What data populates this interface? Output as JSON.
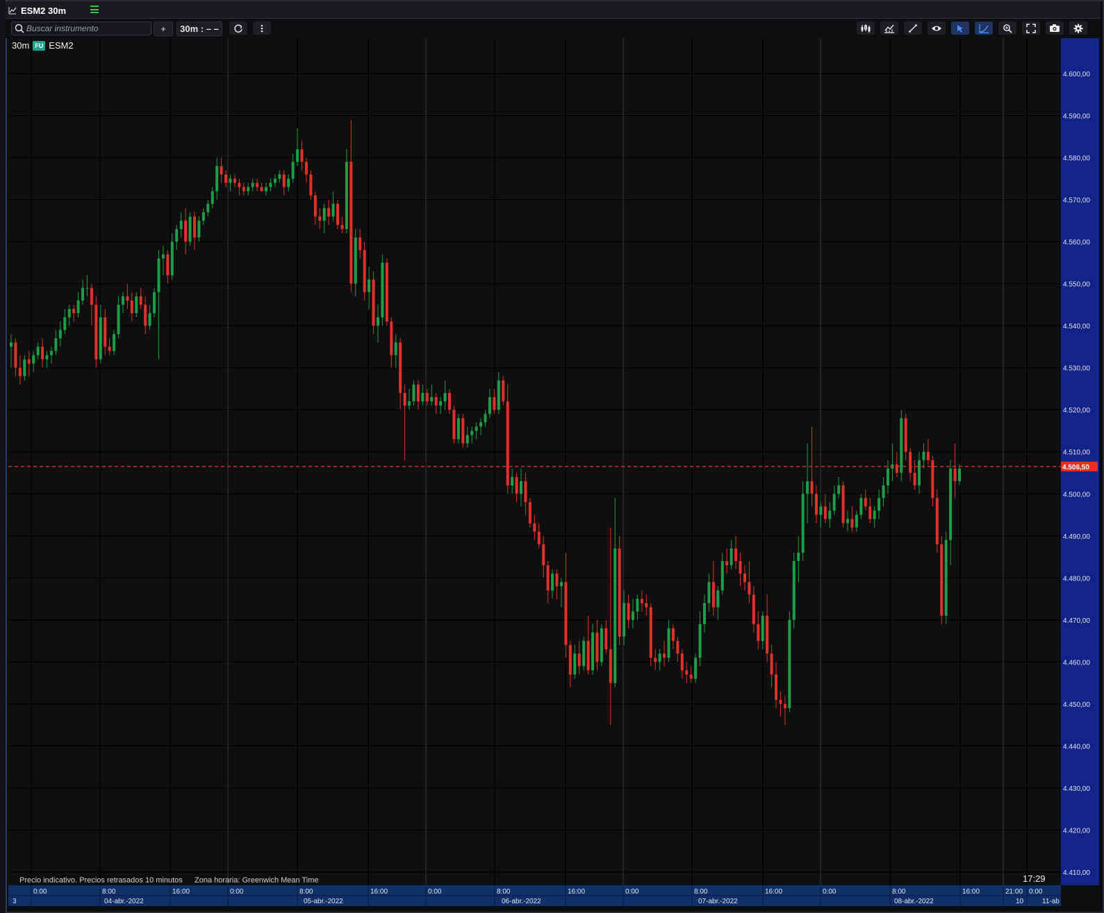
{
  "window": {
    "title": "ESM2 30m"
  },
  "toolbar": {
    "search_placeholder": "Buscar instrumento",
    "add_label": "+",
    "interval_label": "30m : – –",
    "icons": [
      "search-icon",
      "plus-icon",
      "refresh-icon",
      "more-vertical-icon",
      "bar-style-icon",
      "indicators-icon",
      "draw-line-icon",
      "visibility-icon",
      "cursor-icon",
      "curve-draw-icon",
      "zoom-icon",
      "fullscreen-icon",
      "camera-icon",
      "settings-icon"
    ]
  },
  "legend": {
    "interval": "30m",
    "badge": "FU",
    "symbol": "ESM2"
  },
  "footer": {
    "note": "Precio indicativo. Precios retrasados 10 minutos",
    "timezone": "Zona horaria: Greenwich Mean Time",
    "clock": "17:29"
  },
  "colors": {
    "up": "#1f9e4a",
    "down": "#e0322b",
    "axis_bg": "#12248a",
    "time_axis_bg": "#10306b",
    "last_price": "#e0322b"
  },
  "chart_data": {
    "type": "candlestick",
    "y_axis_labels": [
      "4.600,00",
      "4.590,00",
      "4.580,00",
      "4.570,00",
      "4.560,00",
      "4.550,00",
      "4.540,00",
      "4.530,00",
      "4.520,00",
      "4.510,00",
      "4.500,00",
      "4.490,00",
      "4.480,00",
      "4.470,00",
      "4.460,00",
      "4.450,00",
      "4.440,00",
      "4.430,00",
      "4.420,00",
      "4.410,00"
    ],
    "ylim": [
      4408,
      4612
    ],
    "last_price": 4506.5,
    "last_price_label": "4.506,50",
    "time_ticks": [
      "0:00",
      "8:00",
      "16:00",
      "0:00",
      "8:00",
      "16:00",
      "0:00",
      "8:00",
      "16:00",
      "0:00",
      "8:00",
      "16:00",
      "0:00",
      "8:00",
      "16:00",
      "21:00",
      "0:00"
    ],
    "date_labels": [
      "3",
      "04-abr.-2022",
      "05-abr.-2022",
      "06-abr.-2022",
      "07-abr.-2022",
      "08-abr.-2022",
      "10",
      "11-ab"
    ],
    "grid": true,
    "ohlc": [
      [
        4535,
        4538,
        4530,
        4536
      ],
      [
        4536,
        4537,
        4528,
        4530
      ],
      [
        4530,
        4533,
        4526,
        4528
      ],
      [
        4528,
        4533,
        4527,
        4532
      ],
      [
        4532,
        4534,
        4528,
        4531
      ],
      [
        4531,
        4534,
        4529,
        4533
      ],
      [
        4533,
        4536,
        4532,
        4535
      ],
      [
        4535,
        4537,
        4530,
        4532
      ],
      [
        4532,
        4534,
        4530,
        4533
      ],
      [
        4533,
        4535,
        4531,
        4534
      ],
      [
        4534,
        4539,
        4533,
        4537
      ],
      [
        4537,
        4541,
        4535,
        4539
      ],
      [
        4539,
        4544,
        4538,
        4542
      ],
      [
        4542,
        4545,
        4540,
        4544
      ],
      [
        4544,
        4545,
        4541,
        4543
      ],
      [
        4543,
        4548,
        4542,
        4546
      ],
      [
        4546,
        4551,
        4545,
        4549
      ],
      [
        4549,
        4552,
        4547,
        4549
      ],
      [
        4549,
        4550,
        4540,
        4545
      ],
      [
        4545,
        4547,
        4530,
        4532
      ],
      [
        4532,
        4545,
        4531,
        4542
      ],
      [
        4542,
        4544,
        4533,
        4535
      ],
      [
        4535,
        4537,
        4533,
        4534
      ],
      [
        4534,
        4539,
        4533,
        4538
      ],
      [
        4538,
        4547,
        4537,
        4545
      ],
      [
        4545,
        4548,
        4543,
        4547
      ],
      [
        4547,
        4550,
        4544,
        4546
      ],
      [
        4546,
        4548,
        4541,
        4543
      ],
      [
        4543,
        4548,
        4542,
        4547
      ],
      [
        4547,
        4549,
        4544,
        4545
      ],
      [
        4545,
        4547,
        4538,
        4540
      ],
      [
        4540,
        4545,
        4539,
        4543
      ],
      [
        4543,
        4549,
        4542,
        4548
      ],
      [
        4548,
        4558,
        4532,
        4556
      ],
      [
        4556,
        4559,
        4552,
        4557
      ],
      [
        4557,
        4558,
        4550,
        4552
      ],
      [
        4552,
        4562,
        4551,
        4560
      ],
      [
        4560,
        4564,
        4558,
        4563
      ],
      [
        4563,
        4567,
        4561,
        4565
      ],
      [
        4565,
        4568,
        4557,
        4560
      ],
      [
        4560,
        4567,
        4559,
        4566
      ],
      [
        4566,
        4567,
        4558,
        4561
      ],
      [
        4561,
        4566,
        4560,
        4565
      ],
      [
        4565,
        4568,
        4564,
        4567
      ],
      [
        4567,
        4570,
        4566,
        4569
      ],
      [
        4569,
        4573,
        4568,
        4572
      ],
      [
        4572,
        4580,
        4570,
        4578
      ],
      [
        4578,
        4580,
        4574,
        4576
      ],
      [
        4576,
        4577,
        4573,
        4574
      ],
      [
        4574,
        4576,
        4572,
        4575
      ],
      [
        4575,
        4576,
        4573,
        4574
      ],
      [
        4574,
        4575,
        4571,
        4573
      ],
      [
        4573,
        4574,
        4571,
        4572
      ],
      [
        4572,
        4574,
        4571,
        4573
      ],
      [
        4573,
        4575,
        4572,
        4574
      ],
      [
        4574,
        4575,
        4572,
        4573
      ],
      [
        4573,
        4574,
        4572,
        4572
      ],
      [
        4572,
        4574,
        4571,
        4573
      ],
      [
        4573,
        4575,
        4572,
        4574
      ],
      [
        4574,
        4576,
        4573,
        4575
      ],
      [
        4575,
        4577,
        4574,
        4576
      ],
      [
        4576,
        4577,
        4571,
        4573
      ],
      [
        4573,
        4576,
        4572,
        4575
      ],
      [
        4575,
        4581,
        4574,
        4579
      ],
      [
        4579,
        4587,
        4578,
        4582
      ],
      [
        4582,
        4584,
        4577,
        4579
      ],
      [
        4579,
        4580,
        4574,
        4576
      ],
      [
        4576,
        4577,
        4570,
        4571
      ],
      [
        4571,
        4572,
        4564,
        4566
      ],
      [
        4566,
        4568,
        4563,
        4565
      ],
      [
        4565,
        4569,
        4562,
        4568
      ],
      [
        4568,
        4570,
        4564,
        4566
      ],
      [
        4566,
        4572,
        4565,
        4569
      ],
      [
        4569,
        4570,
        4563,
        4564
      ],
      [
        4564,
        4566,
        4562,
        4563
      ],
      [
        4563,
        4582,
        4562,
        4579
      ],
      [
        4579,
        4589,
        4548,
        4550
      ],
      [
        4550,
        4563,
        4547,
        4561
      ],
      [
        4561,
        4563,
        4556,
        4558
      ],
      [
        4558,
        4560,
        4546,
        4548
      ],
      [
        4548,
        4554,
        4544,
        4551
      ],
      [
        4551,
        4553,
        4538,
        4540
      ],
      [
        4540,
        4545,
        4536,
        4542
      ],
      [
        4542,
        4557,
        4540,
        4555
      ],
      [
        4555,
        4556,
        4540,
        4541
      ],
      [
        4541,
        4542,
        4530,
        4533
      ],
      [
        4533,
        4538,
        4530,
        4536
      ],
      [
        4536,
        4537,
        4520,
        4524
      ],
      [
        4524,
        4526,
        4508,
        4521
      ],
      [
        4521,
        4525,
        4520,
        4522
      ],
      [
        4522,
        4527,
        4521,
        4526
      ],
      [
        4526,
        4527,
        4520,
        4522
      ],
      [
        4522,
        4526,
        4521,
        4524
      ],
      [
        4524,
        4525,
        4521,
        4522
      ],
      [
        4522,
        4526,
        4521,
        4523
      ],
      [
        4523,
        4524,
        4519,
        4521
      ],
      [
        4521,
        4523,
        4519,
        4522
      ],
      [
        4522,
        4527,
        4520,
        4524
      ],
      [
        4524,
        4525,
        4519,
        4520
      ],
      [
        4520,
        4521,
        4512,
        4513
      ],
      [
        4513,
        4519,
        4512,
        4518
      ],
      [
        4518,
        4519,
        4511,
        4512
      ],
      [
        4512,
        4516,
        4511,
        4514
      ],
      [
        4514,
        4516,
        4512,
        4515
      ],
      [
        4515,
        4517,
        4513,
        4516
      ],
      [
        4516,
        4518,
        4514,
        4517
      ],
      [
        4517,
        4520,
        4516,
        4519
      ],
      [
        4519,
        4525,
        4518,
        4523
      ],
      [
        4523,
        4525,
        4519,
        4520
      ],
      [
        4520,
        4529,
        4519,
        4527
      ],
      [
        4527,
        4528,
        4521,
        4522
      ],
      [
        4522,
        4526,
        4500,
        4502
      ],
      [
        4502,
        4506,
        4500,
        4504
      ],
      [
        4504,
        4505,
        4498,
        4500
      ],
      [
        4500,
        4506,
        4497,
        4503
      ],
      [
        4503,
        4505,
        4495,
        4498
      ],
      [
        4498,
        4499,
        4492,
        4493
      ],
      [
        4493,
        4495,
        4489,
        4491
      ],
      [
        4491,
        4493,
        4487,
        4488
      ],
      [
        4488,
        4490,
        4480,
        4483
      ],
      [
        4483,
        4484,
        4474,
        4477
      ],
      [
        4477,
        4482,
        4475,
        4481
      ],
      [
        4481,
        4482,
        4475,
        4478
      ],
      [
        4478,
        4480,
        4473,
        4479
      ],
      [
        4479,
        4486,
        4461,
        4464
      ],
      [
        4464,
        4465,
        4454,
        4457
      ],
      [
        4457,
        4464,
        4456,
        4462
      ],
      [
        4462,
        4465,
        4457,
        4459
      ],
      [
        4459,
        4466,
        4458,
        4465
      ],
      [
        4465,
        4471,
        4457,
        4458
      ],
      [
        4458,
        4469,
        4457,
        4467
      ],
      [
        4467,
        4470,
        4458,
        4460
      ],
      [
        4460,
        4469,
        4459,
        4468
      ],
      [
        4468,
        4470,
        4462,
        4463
      ],
      [
        4463,
        4492,
        4445,
        4455
      ],
      [
        4455,
        4499,
        4454,
        4487
      ],
      [
        4487,
        4490,
        4464,
        4466
      ],
      [
        4466,
        4477,
        4464,
        4474
      ],
      [
        4474,
        4476,
        4468,
        4470
      ],
      [
        4470,
        4475,
        4468,
        4472
      ],
      [
        4472,
        4476,
        4470,
        4475
      ],
      [
        4475,
        4477,
        4472,
        4474
      ],
      [
        4474,
        4476,
        4471,
        4473
      ],
      [
        4473,
        4474,
        4459,
        4461
      ],
      [
        4461,
        4463,
        4458,
        4460
      ],
      [
        4460,
        4463,
        4458,
        4462
      ],
      [
        4462,
        4465,
        4459,
        4461
      ],
      [
        4461,
        4470,
        4460,
        4468
      ],
      [
        4468,
        4469,
        4463,
        4465
      ],
      [
        4465,
        4466,
        4460,
        4462
      ],
      [
        4462,
        4463,
        4456,
        4458
      ],
      [
        4458,
        4460,
        4455,
        4457
      ],
      [
        4457,
        4459,
        4455,
        4456
      ],
      [
        4456,
        4462,
        4455,
        4461
      ],
      [
        4461,
        4472,
        4459,
        4469
      ],
      [
        4469,
        4476,
        4467,
        4474
      ],
      [
        4474,
        4481,
        4472,
        4479
      ],
      [
        4479,
        4484,
        4471,
        4473
      ],
      [
        4473,
        4478,
        4470,
        4477
      ],
      [
        4477,
        4486,
        4476,
        4484
      ],
      [
        4484,
        4487,
        4481,
        4483
      ],
      [
        4483,
        4489,
        4482,
        4487
      ],
      [
        4487,
        4490,
        4482,
        4484
      ],
      [
        4484,
        4486,
        4478,
        4481
      ],
      [
        4481,
        4483,
        4477,
        4479
      ],
      [
        4479,
        4484,
        4474,
        4476
      ],
      [
        4476,
        4478,
        4467,
        4469
      ],
      [
        4469,
        4472,
        4463,
        4465
      ],
      [
        4465,
        4472,
        4463,
        4471
      ],
      [
        4471,
        4476,
        4460,
        4462
      ],
      [
        4462,
        4464,
        4454,
        4457
      ],
      [
        4457,
        4460,
        4449,
        4451
      ],
      [
        4451,
        4453,
        4447,
        4450
      ],
      [
        4450,
        4452,
        4445,
        4449
      ],
      [
        4449,
        4472,
        4448,
        4470
      ],
      [
        4470,
        4486,
        4468,
        4484
      ],
      [
        4484,
        4490,
        4479,
        4486
      ],
      [
        4486,
        4503,
        4484,
        4500
      ],
      [
        4500,
        4512,
        4493,
        4503
      ],
      [
        4503,
        4516,
        4497,
        4500
      ],
      [
        4500,
        4502,
        4493,
        4495
      ],
      [
        4495,
        4498,
        4492,
        4497
      ],
      [
        4497,
        4500,
        4493,
        4494
      ],
      [
        4494,
        4498,
        4492,
        4496
      ],
      [
        4496,
        4502,
        4495,
        4500
      ],
      [
        4500,
        4504,
        4499,
        4502
      ],
      [
        4502,
        4503,
        4492,
        4493
      ],
      [
        4493,
        4496,
        4491,
        4494
      ],
      [
        4494,
        4497,
        4491,
        4492
      ],
      [
        4492,
        4496,
        4491,
        4495
      ],
      [
        4495,
        4500,
        4494,
        4499
      ],
      [
        4499,
        4501,
        4496,
        4497
      ],
      [
        4497,
        4499,
        4493,
        4494
      ],
      [
        4494,
        4497,
        4492,
        4496
      ],
      [
        4496,
        4501,
        4494,
        4499
      ],
      [
        4499,
        4504,
        4497,
        4502
      ],
      [
        4502,
        4508,
        4500,
        4506
      ],
      [
        4506,
        4512,
        4503,
        4507
      ],
      [
        4507,
        4510,
        4504,
        4505
      ],
      [
        4505,
        4520,
        4503,
        4518
      ],
      [
        4518,
        4519,
        4508,
        4510
      ],
      [
        4510,
        4511,
        4503,
        4505
      ],
      [
        4505,
        4508,
        4501,
        4502
      ],
      [
        4502,
        4510,
        4500,
        4508
      ],
      [
        4508,
        4512,
        4506,
        4510
      ],
      [
        4510,
        4513,
        4507,
        4508
      ],
      [
        4508,
        4509,
        4497,
        4499
      ],
      [
        4499,
        4501,
        4486,
        4488
      ],
      [
        4488,
        4490,
        4469,
        4471
      ],
      [
        4471,
        4491,
        4469,
        4489
      ],
      [
        4489,
        4508,
        4483,
        4506
      ],
      [
        4506,
        4512,
        4499,
        4503
      ],
      [
        4503,
        4507,
        4502,
        4506
      ]
    ]
  }
}
